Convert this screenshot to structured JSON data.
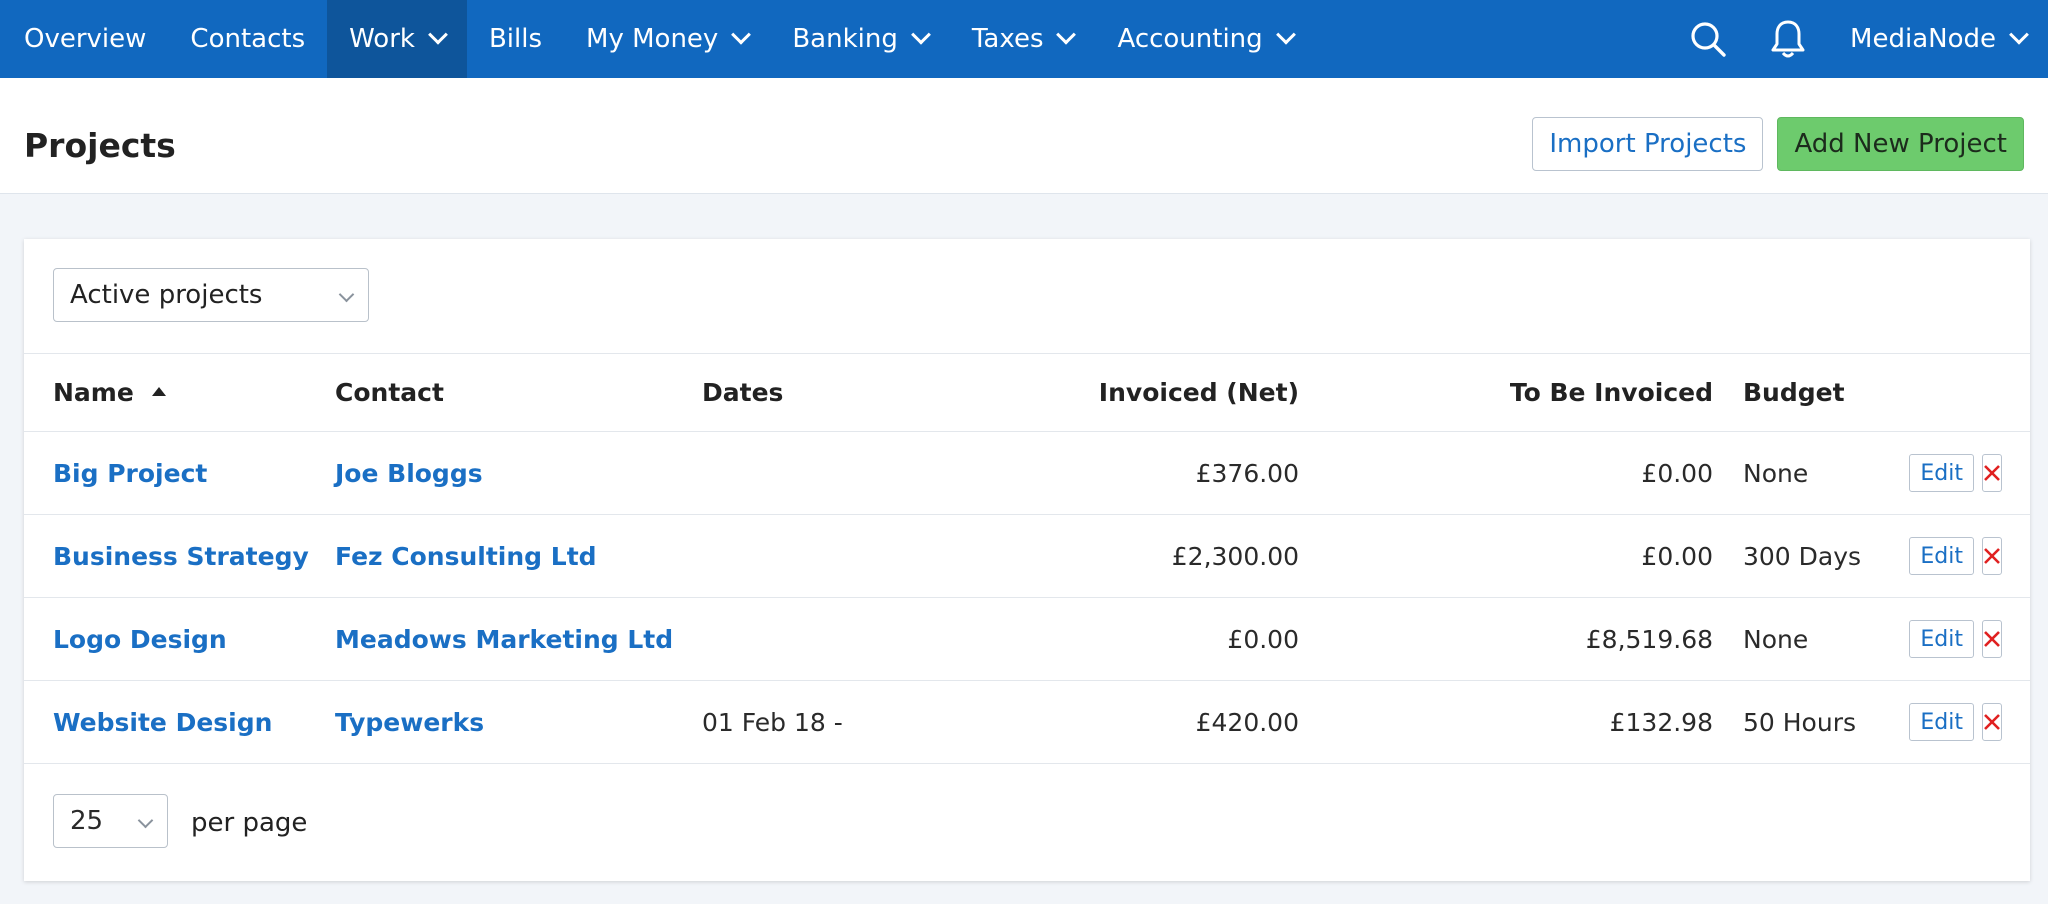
{
  "nav": {
    "items": [
      {
        "label": "Overview",
        "has_dropdown": false,
        "active": false
      },
      {
        "label": "Contacts",
        "has_dropdown": false,
        "active": false
      },
      {
        "label": "Work",
        "has_dropdown": true,
        "active": true
      },
      {
        "label": "Bills",
        "has_dropdown": false,
        "active": false
      },
      {
        "label": "My Money",
        "has_dropdown": true,
        "active": false
      },
      {
        "label": "Banking",
        "has_dropdown": true,
        "active": false
      },
      {
        "label": "Taxes",
        "has_dropdown": true,
        "active": false
      },
      {
        "label": "Accounting",
        "has_dropdown": true,
        "active": false
      }
    ],
    "user": "MediaNode",
    "icons": [
      "search-icon",
      "bell-icon"
    ]
  },
  "header": {
    "title": "Projects",
    "import_label": "Import Projects",
    "add_label": "Add New Project"
  },
  "filter": {
    "selected": "Active projects"
  },
  "table": {
    "columns": {
      "name": "Name",
      "contact": "Contact",
      "dates": "Dates",
      "invoiced": "Invoiced (Net)",
      "to_be_invoiced": "To Be Invoiced",
      "budget": "Budget"
    },
    "sort": {
      "column": "name",
      "direction": "ascending"
    },
    "rows": [
      {
        "name": "Big Project",
        "contact": "Joe Bloggs",
        "dates": "",
        "invoiced": "£376.00",
        "to_be_invoiced": "£0.00",
        "budget": "None",
        "edit": "Edit"
      },
      {
        "name": "Business Strategy",
        "contact": "Fez Consulting Ltd",
        "dates": "",
        "invoiced": "£2,300.00",
        "to_be_invoiced": "£0.00",
        "budget": "300 Days",
        "edit": "Edit"
      },
      {
        "name": "Logo Design",
        "contact": "Meadows Marketing Ltd",
        "dates": "",
        "invoiced": "£0.00",
        "to_be_invoiced": "£8,519.68",
        "budget": "None",
        "edit": "Edit"
      },
      {
        "name": "Website Design",
        "contact": "Typewerks",
        "dates": "01 Feb 18 -",
        "invoiced": "£420.00",
        "to_be_invoiced": "£132.98",
        "budget": "50 Hours",
        "edit": "Edit"
      }
    ]
  },
  "pagination": {
    "per_page": "25",
    "per_page_label": "per page"
  },
  "colors": {
    "nav_bg": "#1168bf",
    "nav_active": "#0e559b",
    "link": "#1a6fc4",
    "add_button": "#6dcb6d",
    "delete": "#e02020"
  }
}
